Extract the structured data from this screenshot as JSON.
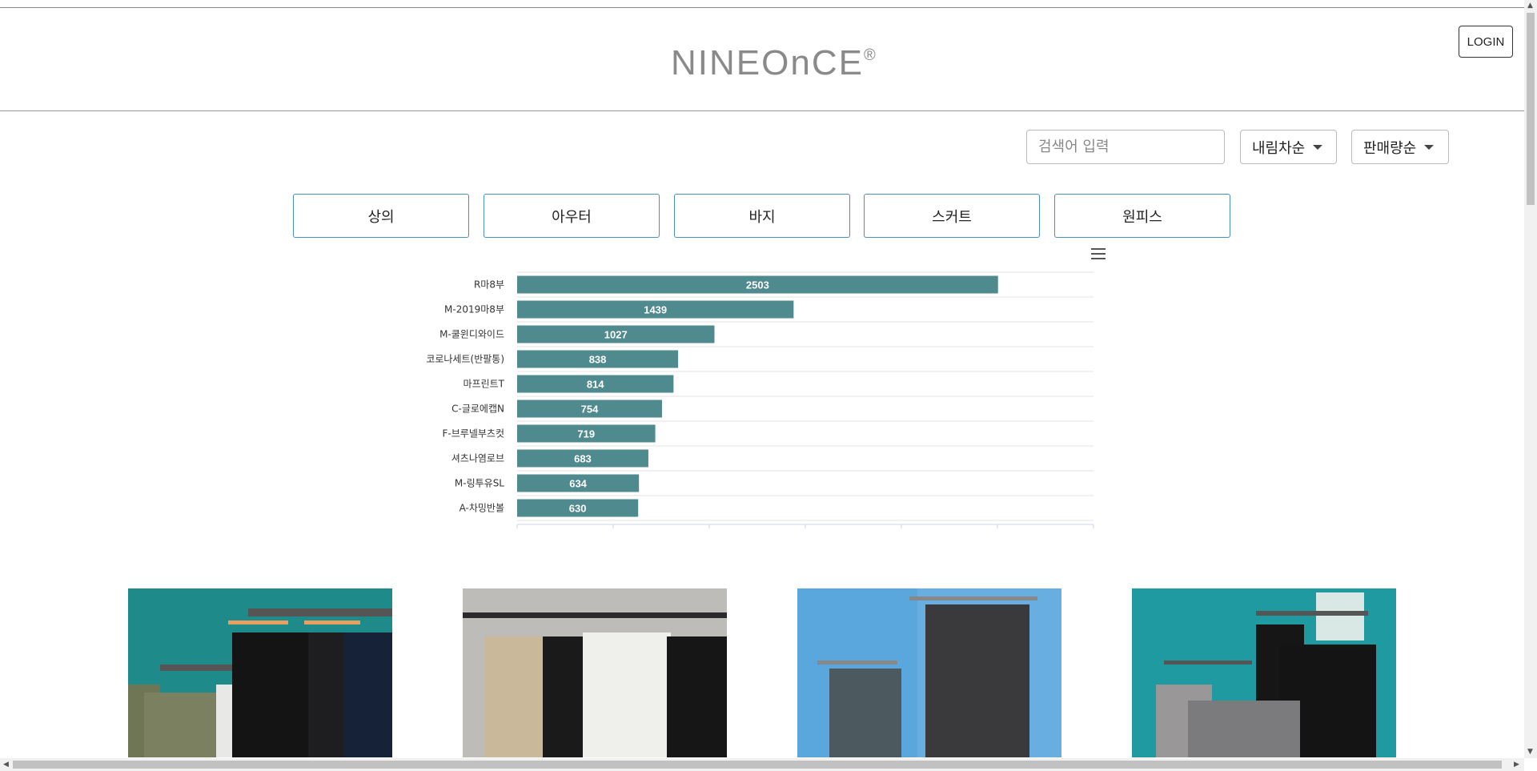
{
  "header": {
    "logo_text": "NINEOnCE",
    "logo_mark": "®",
    "login_label": "LOGIN"
  },
  "toolbar": {
    "search_placeholder": "검색어 입력",
    "order_label": "내림차순",
    "sort_label": "판매량순"
  },
  "categories": [
    "상의",
    "아우터",
    "바지",
    "스커트",
    "원피스"
  ],
  "chart_data": {
    "type": "bar",
    "orientation": "horizontal",
    "categories": [
      "R마8부",
      "M-2019마8부",
      "M-쿨윈디와이드",
      "코로나세트(반팔통)",
      "마프린트T",
      "C-글로에캡N",
      "F-브루넬부츠컷",
      "셔츠나염로브",
      "M-링투유SL",
      "A-차밍반볼"
    ],
    "values": [
      2503,
      1439,
      1027,
      838,
      814,
      754,
      719,
      683,
      634,
      630
    ],
    "xlim": [
      0,
      3000
    ],
    "grid": true,
    "colors": {
      "bar": "#4f8a8f",
      "label": "#ffffff"
    }
  },
  "products": [
    {
      "name": "olive-white-black-shorts-photo"
    },
    {
      "name": "beige-black-white-pants-photo"
    },
    {
      "name": "gray-knit-skirts-photo"
    },
    {
      "name": "black-gray-tshirts-photo"
    }
  ]
}
